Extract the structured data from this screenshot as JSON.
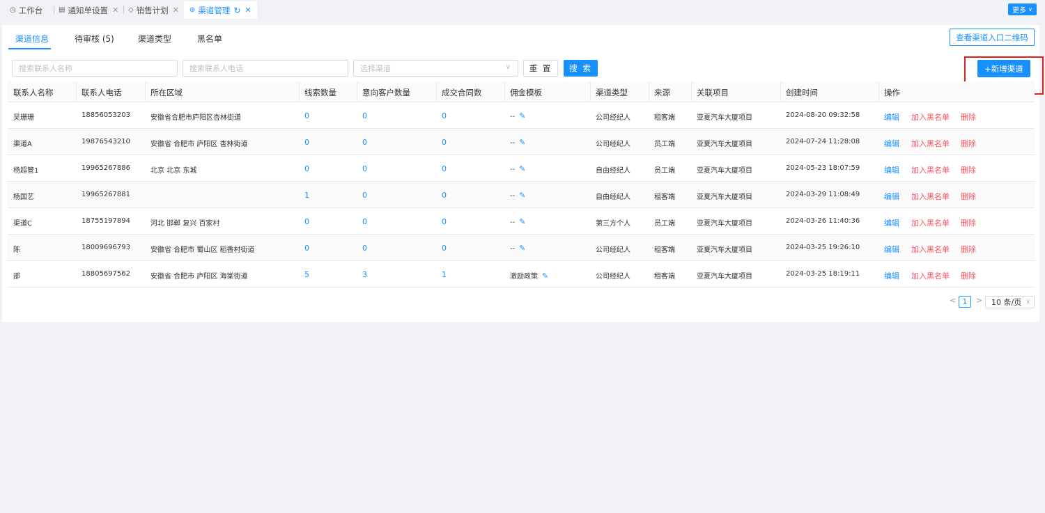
{
  "tabs": [
    {
      "icon": "gauge-icon",
      "label": "工作台"
    },
    {
      "icon": "document-icon",
      "label": "通知单设置"
    },
    {
      "icon": "tag-icon",
      "label": "销售计划"
    },
    {
      "icon": "settings-icon",
      "label": "渠道管理"
    }
  ],
  "more_label": "更多",
  "subtabs": [
    "渠道信息",
    "待审核 (5)",
    "渠道类型",
    "黑名单"
  ],
  "qr_button": "查看渠道入口二维码",
  "filters": {
    "name_placeholder": "搜索联系人名称",
    "phone_placeholder": "搜索联系人电话",
    "channel_placeholder": "选择渠道",
    "reset": "重 置",
    "search": "搜 索",
    "add": "+新增渠道"
  },
  "columns": [
    "联系人名称",
    "联系人电话",
    "所在区域",
    "线索数量",
    "意向客户数量",
    "成交合同数",
    "佣金模板",
    "渠道类型",
    "来源",
    "关联项目",
    "创建时间",
    "操作"
  ],
  "rows": [
    {
      "name": "吴珊珊",
      "phone": "18856053203",
      "region": "安徽省合肥市庐阳区杏林街道",
      "leads": "0",
      "intent": "0",
      "deals": "0",
      "template": "--",
      "type": "公司经纪人",
      "source": "租客端",
      "project": "亚夏汽车大厦项目",
      "created": "2024-08-20 09:32:58"
    },
    {
      "name": "渠道A",
      "phone": "19876543210",
      "region": "安徽省 合肥市 庐阳区 杏林街道",
      "leads": "0",
      "intent": "0",
      "deals": "0",
      "template": "--",
      "type": "公司经纪人",
      "source": "员工端",
      "project": "亚夏汽车大厦项目",
      "created": "2024-07-24 11:28:08"
    },
    {
      "name": "杨超管1",
      "phone": "19965267886",
      "region": "北京 北京 东城",
      "leads": "0",
      "intent": "0",
      "deals": "0",
      "template": "--",
      "type": "自由经纪人",
      "source": "员工端",
      "project": "亚夏汽车大厦项目",
      "created": "2024-05-23 18:07:59"
    },
    {
      "name": "杨国艺",
      "phone": "19965267881",
      "region": "",
      "leads": "1",
      "intent": "0",
      "deals": "0",
      "template": "--",
      "type": "自由经纪人",
      "source": "租客端",
      "project": "亚夏汽车大厦项目",
      "created": "2024-03-29 11:08:49"
    },
    {
      "name": "渠道C",
      "phone": "18755197894",
      "region": "河北 邯郸 复兴 百家村",
      "leads": "0",
      "intent": "0",
      "deals": "0",
      "template": "--",
      "type": "第三方个人",
      "source": "员工端",
      "project": "亚夏汽车大厦项目",
      "created": "2024-03-26 11:40:36"
    },
    {
      "name": "陈",
      "phone": "18009696793",
      "region": "安徽省 合肥市 蜀山区 稻香村街道",
      "leads": "0",
      "intent": "0",
      "deals": "0",
      "template": "--",
      "type": "公司经纪人",
      "source": "租客端",
      "project": "亚夏汽车大厦项目",
      "created": "2024-03-25 19:26:10"
    },
    {
      "name": "邵",
      "phone": "18805697562",
      "region": "安徽省 合肥市 庐阳区 海棠街道",
      "leads": "5",
      "intent": "3",
      "deals": "1",
      "template": "激励政策",
      "type": "公司经纪人",
      "source": "租客端",
      "project": "亚夏汽车大厦项目",
      "created": "2024-03-25 18:19:11"
    }
  ],
  "actions": {
    "edit": "编辑",
    "blacklist": "加入黑名单",
    "delete": "删除"
  },
  "pagination": {
    "prev": "<",
    "current": "1",
    "next": ">",
    "page_size": "10 条/页"
  },
  "colors": {
    "primary": "#1890ff",
    "danger": "#f5515f",
    "highlight": "#e02020"
  }
}
